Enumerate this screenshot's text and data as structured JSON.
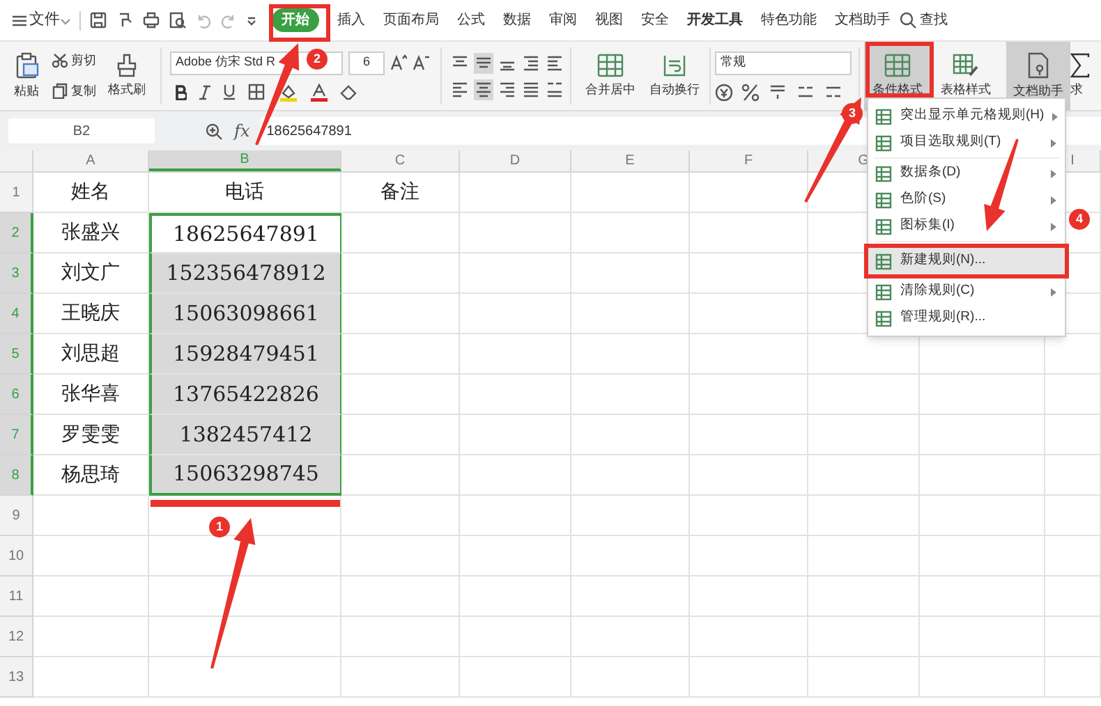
{
  "menu_bar": {
    "file": "文件",
    "tabs": [
      {
        "label": "开始",
        "selected": true
      },
      {
        "label": "插入",
        "selected": false
      },
      {
        "label": "页面布局",
        "selected": false
      },
      {
        "label": "公式",
        "selected": false
      },
      {
        "label": "数据",
        "selected": false
      },
      {
        "label": "审阅",
        "selected": false
      },
      {
        "label": "视图",
        "selected": false
      },
      {
        "label": "安全",
        "selected": false
      },
      {
        "label": "开发工具",
        "selected": false
      },
      {
        "label": "特色功能",
        "selected": false
      },
      {
        "label": "文档助手",
        "selected": false
      }
    ],
    "search": "查找"
  },
  "ribbon": {
    "paste": "粘贴",
    "cut": "剪切",
    "copy": "复制",
    "format_painter": "格式刷",
    "font_name": "Adobe 仿宋 Std R",
    "font_size": "6",
    "merge_center": "合并居中",
    "wrap_text": "自动换行",
    "number_format": "常规",
    "conditional_format": "条件格式",
    "table_style": "表格样式",
    "doc_assistant": "文档助手",
    "sum": "求"
  },
  "formula_bar": {
    "cell_ref": "B2",
    "fx": "fx",
    "value": "18625647891"
  },
  "sheet": {
    "columns": [
      {
        "label": "A",
        "selected": false
      },
      {
        "label": "B",
        "selected": true
      },
      {
        "label": "C",
        "selected": false
      },
      {
        "label": "D",
        "selected": false
      },
      {
        "label": "E",
        "selected": false
      },
      {
        "label": "F",
        "selected": false
      },
      {
        "label": "G",
        "selected": false
      },
      {
        "label": "I",
        "selected": false
      }
    ],
    "rows": [
      {
        "number": "1",
        "selected": false,
        "name": "姓名",
        "phone": {
          "text": "电话",
          "active": false
        },
        "note": "备注"
      },
      {
        "number": "2",
        "selected": true,
        "name": "张盛兴",
        "phone": {
          "text": "18625647891",
          "active": true
        }
      },
      {
        "number": "3",
        "selected": true,
        "name": "刘文广",
        "phone": {
          "text": "152356478912",
          "active": false
        }
      },
      {
        "number": "4",
        "selected": true,
        "name": "王晓庆",
        "phone": {
          "text": "15063098661",
          "active": false
        }
      },
      {
        "number": "5",
        "selected": true,
        "name": "刘思超",
        "phone": {
          "text": "15928479451",
          "active": false
        }
      },
      {
        "number": "6",
        "selected": true,
        "name": "张华喜",
        "phone": {
          "text": "13765422826",
          "active": false
        }
      },
      {
        "number": "7",
        "selected": true,
        "name": "罗雯雯",
        "phone": {
          "text": "1382457412",
          "active": false
        }
      },
      {
        "number": "8",
        "selected": true,
        "name": "杨思琦",
        "phone": {
          "text": "15063298745",
          "active": false
        }
      },
      {
        "number": "9",
        "selected": false
      },
      {
        "number": "10",
        "selected": false
      },
      {
        "number": "11",
        "selected": false
      },
      {
        "number": "12",
        "selected": false
      },
      {
        "number": "13",
        "selected": false
      }
    ]
  },
  "context_menu": {
    "items": [
      {
        "label": "突出显示单元格规则(H)",
        "has_submenu": true,
        "selected": false
      },
      {
        "label": "项目选取规则(T)",
        "has_submenu": true,
        "selected": false
      },
      {
        "label": "数据条(D)",
        "has_submenu": true,
        "selected": false
      },
      {
        "label": "色阶(S)",
        "has_submenu": true,
        "selected": false
      },
      {
        "label": "图标集(I)",
        "has_submenu": true,
        "selected": false
      },
      {
        "label": "新建规则(N)...",
        "has_submenu": false,
        "selected": true
      },
      {
        "label": "清除规则(C)",
        "has_submenu": true,
        "selected": false
      },
      {
        "label": "管理规则(R)...",
        "has_submenu": false,
        "selected": false
      }
    ]
  },
  "annotations": [
    {
      "number": "1"
    },
    {
      "number": "2"
    },
    {
      "number": "3"
    },
    {
      "number": "4"
    }
  ]
}
